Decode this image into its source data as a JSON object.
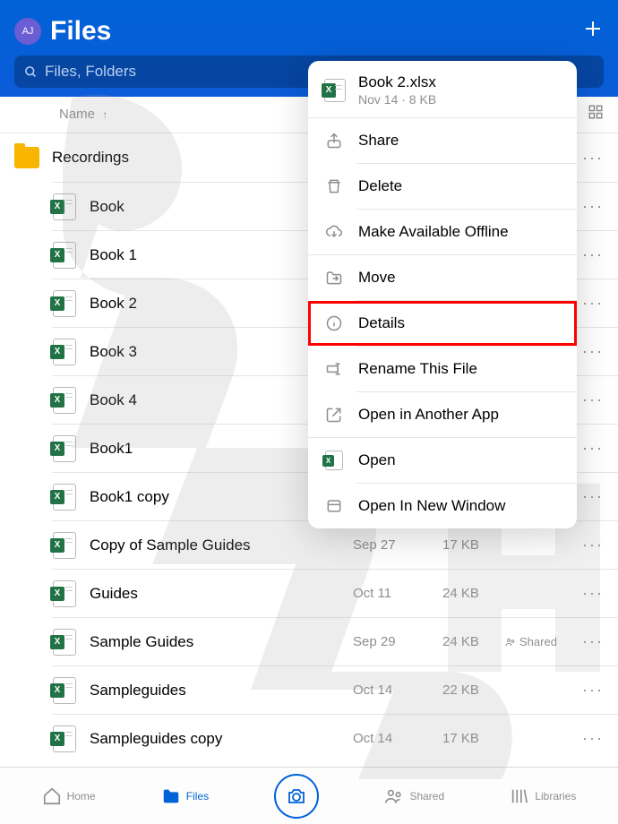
{
  "header": {
    "avatar_initials": "AJ",
    "title": "Files",
    "search_placeholder": "Files, Folders"
  },
  "columns": {
    "name_label": "Name",
    "sort_indicator": "↑"
  },
  "files": [
    {
      "name": "Recordings",
      "type": "folder",
      "date": "",
      "size": "",
      "shared": ""
    },
    {
      "name": "Book",
      "type": "xlsx",
      "date": "",
      "size": "",
      "shared": ""
    },
    {
      "name": "Book 1",
      "type": "xlsx",
      "date": "",
      "size": "",
      "shared": ""
    },
    {
      "name": "Book 2",
      "type": "xlsx",
      "date": "",
      "size": "",
      "shared": ""
    },
    {
      "name": "Book 3",
      "type": "xlsx",
      "date": "",
      "size": "",
      "shared": ""
    },
    {
      "name": "Book 4",
      "type": "xlsx",
      "date": "",
      "size": "",
      "shared": ""
    },
    {
      "name": "Book1",
      "type": "xlsx",
      "date": "",
      "size": "",
      "shared": ""
    },
    {
      "name": "Book1 copy",
      "type": "xlsx",
      "date": "",
      "size": "",
      "shared": ""
    },
    {
      "name": "Copy of Sample Guides",
      "type": "xlsx",
      "date": "Sep 27",
      "size": "17 KB",
      "shared": ""
    },
    {
      "name": "Guides",
      "type": "xlsx",
      "date": "Oct 11",
      "size": "24 KB",
      "shared": ""
    },
    {
      "name": "Sample Guides",
      "type": "xlsx",
      "date": "Sep 29",
      "size": "24 KB",
      "shared": "Shared"
    },
    {
      "name": "Sampleguides",
      "type": "xlsx",
      "date": "Oct 14",
      "size": "22 KB",
      "shared": ""
    },
    {
      "name": "Sampleguides copy",
      "type": "xlsx",
      "date": "Oct 14",
      "size": "17 KB",
      "shared": ""
    }
  ],
  "context_menu": {
    "file_title": "Book 2.xlsx",
    "file_subtitle": "Nov 14 · 8 KB",
    "items": [
      {
        "icon": "share",
        "label": "Share"
      },
      {
        "icon": "trash",
        "label": "Delete"
      },
      {
        "icon": "cloud-download",
        "label": "Make Available Offline"
      },
      {
        "icon": "folder-move",
        "label": "Move"
      },
      {
        "icon": "info",
        "label": "Details",
        "highlighted": true
      },
      {
        "icon": "rename",
        "label": "Rename This File"
      },
      {
        "icon": "open-external",
        "label": "Open in Another App"
      },
      {
        "icon": "excel",
        "label": "Open"
      },
      {
        "icon": "window",
        "label": "Open In New Window"
      }
    ]
  },
  "nav": {
    "home": "Home",
    "files": "Files",
    "shared": "Shared",
    "libraries": "Libraries"
  }
}
